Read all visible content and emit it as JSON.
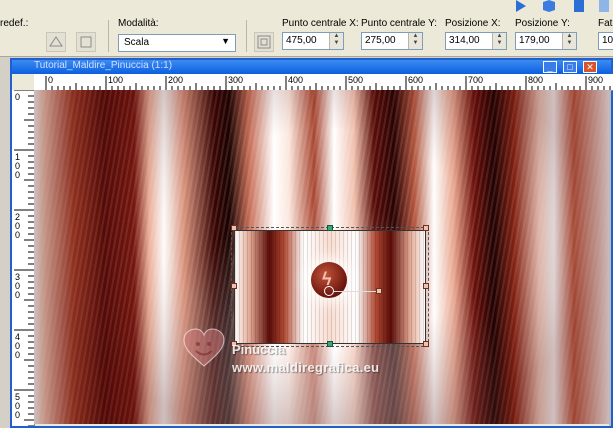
{
  "toolbar": {
    "preset_label": "redef.:",
    "mode_label": "Modalità:",
    "mode_value": "Scala",
    "center_x_label": "Punto centrale X:",
    "center_x_value": "475,00",
    "center_y_label": "Punto centrale Y:",
    "center_y_value": "275,00",
    "pos_x_label": "Posizione X:",
    "pos_x_value": "314,00",
    "pos_y_label": "Posizione Y:",
    "pos_y_value": "179,00",
    "next_label": "Fat",
    "next_value": "10"
  },
  "window": {
    "title": "Tutorial_Maldire_Pinuccia (1:1)"
  },
  "ruler_top": [
    "0",
    "100",
    "200",
    "300",
    "400",
    "500",
    "600",
    "700",
    "800",
    "900"
  ],
  "ruler_left": [
    "0",
    "1\n0\n0",
    "2\n0\n0",
    "3\n0\n0",
    "4\n0\n0",
    "5\n0\n0"
  ],
  "watermark": {
    "name": "Pinuccia",
    "url": "www.maldiregrafica.eu"
  },
  "colors": {
    "accent_blue": "#1f5fd0",
    "handle_green": "#3fa67a"
  }
}
